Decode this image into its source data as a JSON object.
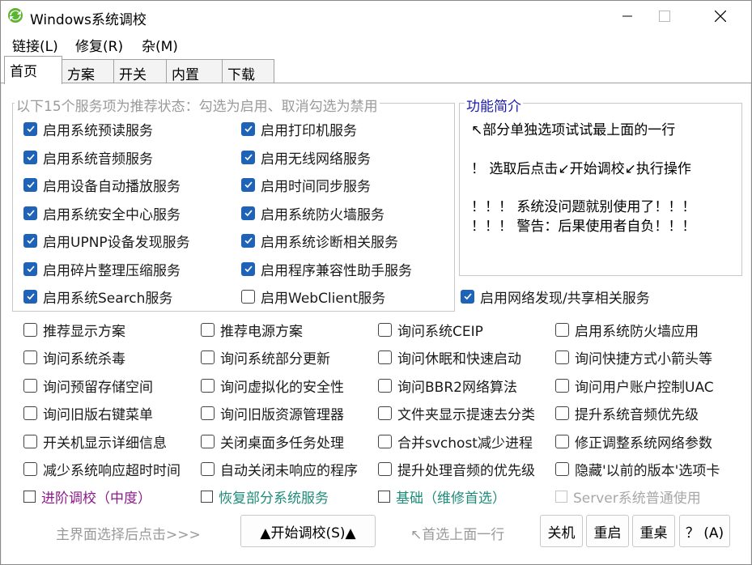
{
  "window": {
    "title": "Windows系统调校"
  },
  "menu": [
    "链接(L)",
    "修复(R)",
    "杂(M)"
  ],
  "tabs": [
    "首页",
    "方案",
    "开关",
    "内置",
    "下载"
  ],
  "services_group": {
    "legend": "以下15个服务项为推荐状态：勾选为启用、取消勾选为禁用",
    "items": [
      {
        "label": "启用系统预读服务",
        "checked": true
      },
      {
        "label": "启用打印机服务",
        "checked": true
      },
      {
        "label": "启用系统音频服务",
        "checked": true
      },
      {
        "label": "启用无线网络服务",
        "checked": true
      },
      {
        "label": "启用设备自动播放服务",
        "checked": true
      },
      {
        "label": "启用时间同步服务",
        "checked": true
      },
      {
        "label": "启用系统安全中心服务",
        "checked": true
      },
      {
        "label": "启用系统防火墙服务",
        "checked": true
      },
      {
        "label": "启用UPNP设备发现服务",
        "checked": true
      },
      {
        "label": "启用系统诊断相关服务",
        "checked": true
      },
      {
        "label": "启用碎片整理压缩服务",
        "checked": true
      },
      {
        "label": "启用程序兼容性助手服务",
        "checked": true
      },
      {
        "label": "启用系统Search服务",
        "checked": true
      },
      {
        "label": "启用WebClient服务",
        "checked": false
      },
      {
        "label": "启用网络发现/共享相关服务",
        "checked": true
      }
    ]
  },
  "info_group": {
    "legend": "功能简介",
    "lines": [
      "↖部分单独选项试试最上面的一行",
      "！ 选取后点击↙开始调校↙执行操作",
      "！！！ 系统没问题就别使用了！！！",
      "！！！ 警告：后果使用者自负！！！"
    ]
  },
  "options": [
    [
      "推荐显示方案",
      "推荐电源方案",
      "询问系统CEIP",
      "启用系统防火墙应用"
    ],
    [
      "询问系统杀毒",
      "询问系统部分更新",
      "询问休眠和快速启动",
      "询问快捷方式小箭头等"
    ],
    [
      "询问预留存储空间",
      "询问虚拟化的安全性",
      "询问BBR2网络算法",
      "询问用户账户控制UAC"
    ],
    [
      "询问旧版右键菜单",
      "询问旧版资源管理器",
      "文件夹显示提速去分类",
      "提升系统音频优先级"
    ],
    [
      "开关机显示详细信息",
      "关闭桌面多任务处理",
      "合并svchost减少进程",
      "修正调整系统网络参数"
    ],
    [
      "减少系统响应超时时间",
      "自动关闭未响应的程序",
      "提升处理音频的优先级",
      "隐藏'以前的版本'选项卡"
    ]
  ],
  "presets": [
    {
      "label": "进阶调校（中度）",
      "color": "#8b1a8b"
    },
    {
      "label": "恢复部分系统服务",
      "color": "#1f8c7a"
    },
    {
      "label": "基础（维修首选）",
      "color": "#1f8c7a"
    },
    {
      "label": "Server系统普通使用",
      "color": "#a8a8a8"
    }
  ],
  "bottom": {
    "hint_left": "主界面选择后点击>>>",
    "start_button": "▲开始调校(S)▲",
    "hint_right": "↖首选上面一行",
    "buttons": [
      "关机",
      "重启",
      "重桌",
      "？ (A)"
    ]
  }
}
